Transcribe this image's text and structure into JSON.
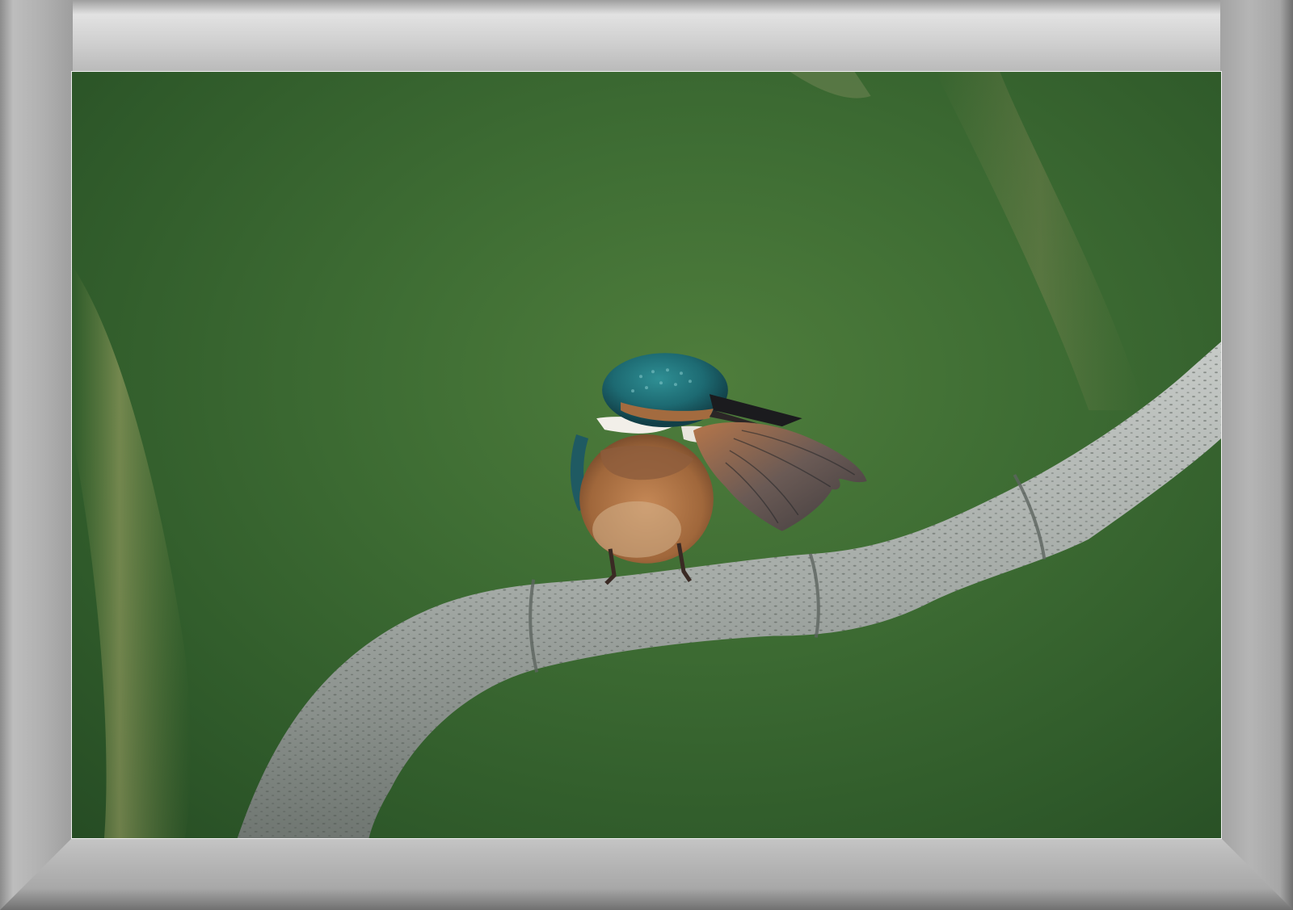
{
  "image": {
    "subject": "",
    "background_color": "#3f6e34",
    "frame_color": "#b5b5b5",
    "branch_color": "#a7aca8"
  }
}
